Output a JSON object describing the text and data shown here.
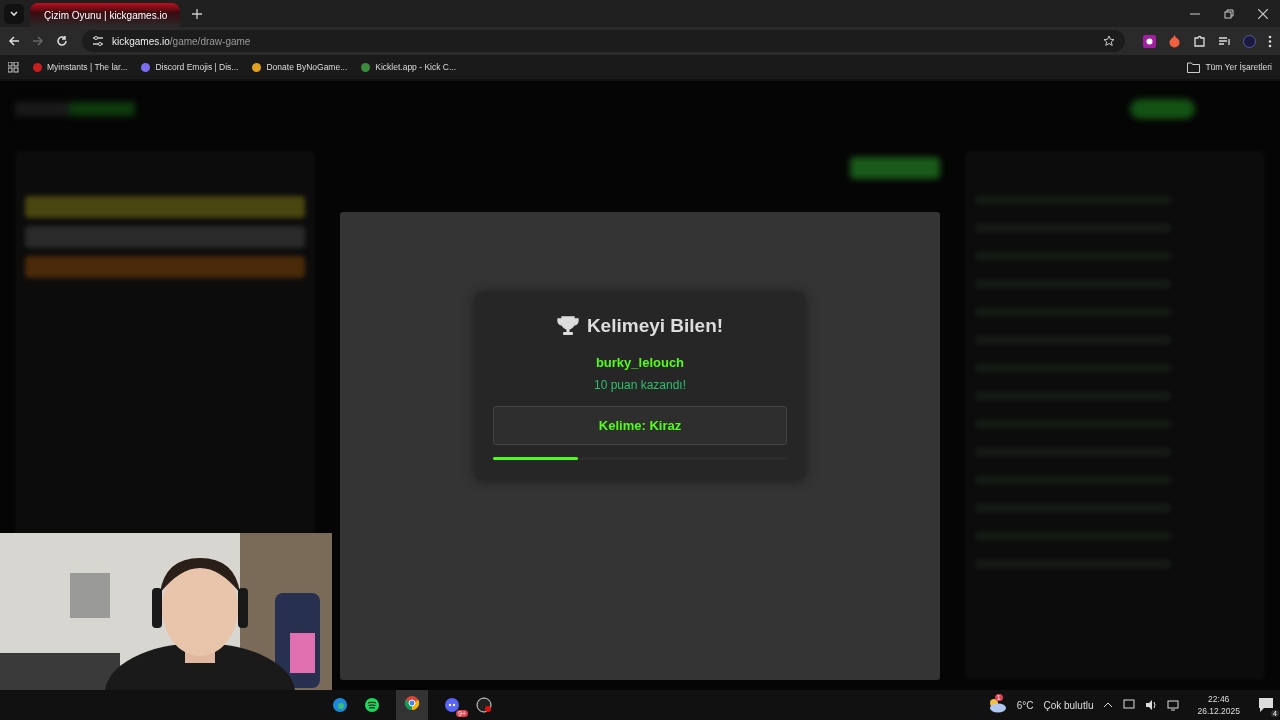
{
  "browser": {
    "tab_title": "Çizim Oyunu | kickgames.io",
    "url_host": "kickgames.io",
    "url_path": "/game/draw-game",
    "bookmarks": [
      {
        "label": "Myinstants | The lar...",
        "color": "#c81e1e"
      },
      {
        "label": "Discord Emojis | Dis...",
        "color": "#7b6cf0"
      },
      {
        "label": "Donate ByNoGame...",
        "color": "#e0a020"
      },
      {
        "label": "Kicklet.app - Kick C...",
        "color": "#3c8a3c"
      }
    ],
    "all_bookmarks": "Tüm Yer İşaretleri"
  },
  "modal": {
    "title": "Kelimeyi Bilen!",
    "winner": "burky_lelouch",
    "points": "10 puan kazandı!",
    "word": "Kelime: Kiraz",
    "level": 0.29
  },
  "taskbar": {
    "discord_badge": "9+",
    "weather_badge": "1",
    "temperature": "6°C",
    "weather": "Çok bulutlu",
    "time": "22:46",
    "date": "26.12.2025",
    "notifications": "4"
  }
}
